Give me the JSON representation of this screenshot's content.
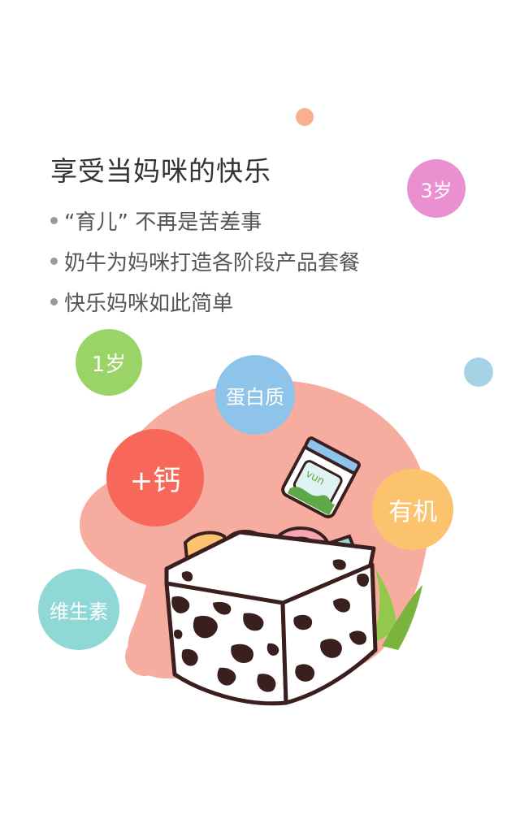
{
  "headline": "享受当妈咪的快乐",
  "features": [
    {
      "text": "“育儿” 不再是苦差事"
    },
    {
      "text": "奶牛为妈咪打造各阶段产品套餐"
    },
    {
      "text": "快乐妈咪如此简单"
    }
  ],
  "tags": {
    "age_3": "3岁",
    "age_1": "1岁",
    "protein": "蛋白质",
    "calcium": "+钙",
    "organic": "有机",
    "vitamin": "维生素"
  },
  "jar_label": "vun",
  "colors": {
    "pink_blob": "#f7aca0",
    "magenta": "#ea8fd0",
    "lime": "#9ad466",
    "sky": "#8fc4ea",
    "coral": "#f7685a",
    "amber": "#fcc36e",
    "teal": "#8fd8d6",
    "dot_orange": "#fab08e",
    "dot_blue": "#a5d3e5"
  }
}
